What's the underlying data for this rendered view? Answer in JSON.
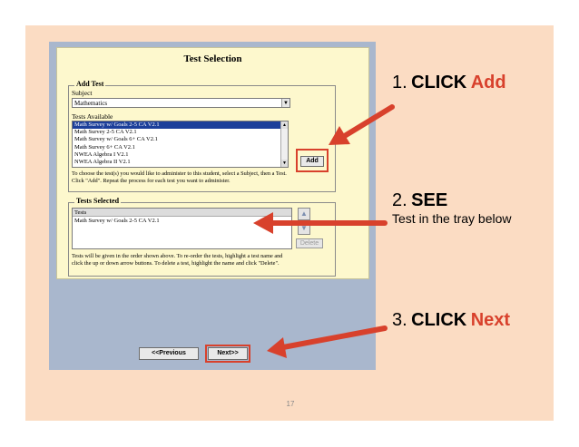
{
  "window": {
    "title": "Test Selection",
    "add_test": {
      "legend": "Add Test",
      "subject_label": "Subject",
      "subject_value": "Mathematics",
      "tests_available_label": "Tests Available",
      "tests_available": [
        "Math Survey w/ Goals 2-5 CA V2.1",
        "Math Survey 2-5 CA V2.1",
        "Math Survey w/ Goals 6+ CA V2.1",
        "Math Survey 6+ CA V2.1",
        "NWEA Algebra I V2.1",
        "NWEA Algebra II V2.1"
      ],
      "add_button": "Add",
      "instructions_line1": "To choose the test(s) you would like to administer to this student, select a Subject, then a Test.",
      "instructions_line2": "Click \"Add\".  Repeat the process for each test you want to administer."
    },
    "tests_selected": {
      "legend": "Tests Selected",
      "column_header": "Tests",
      "rows": [
        "Math Survey w/ Goals 2-5 CA V2.1"
      ],
      "delete_button": "Delete",
      "instructions_line1": "Tests will be given in the order shown above.  To re-order the tests, highlight a test name and",
      "instructions_line2": "click the up or down arrow buttons.  To delete a test, highlight the name and click \"Delete\"."
    },
    "previous_button": "<<Previous",
    "next_button": "Next>>"
  },
  "callouts": {
    "step1": {
      "number": "1.",
      "action": "CLICK",
      "target": "Add"
    },
    "step2": {
      "number": "2.",
      "action": "SEE",
      "detail": "Test in the tray below"
    },
    "step3": {
      "number": "3.",
      "action": "CLICK",
      "target": "Next"
    }
  },
  "page_number": "17",
  "colors": {
    "slide_background": "#fbdcc3",
    "panel_background": "#a9b7cd",
    "window_background": "#fdf8cd",
    "highlight_red": "#d8412c",
    "selection_blue": "#1c3f9a"
  }
}
